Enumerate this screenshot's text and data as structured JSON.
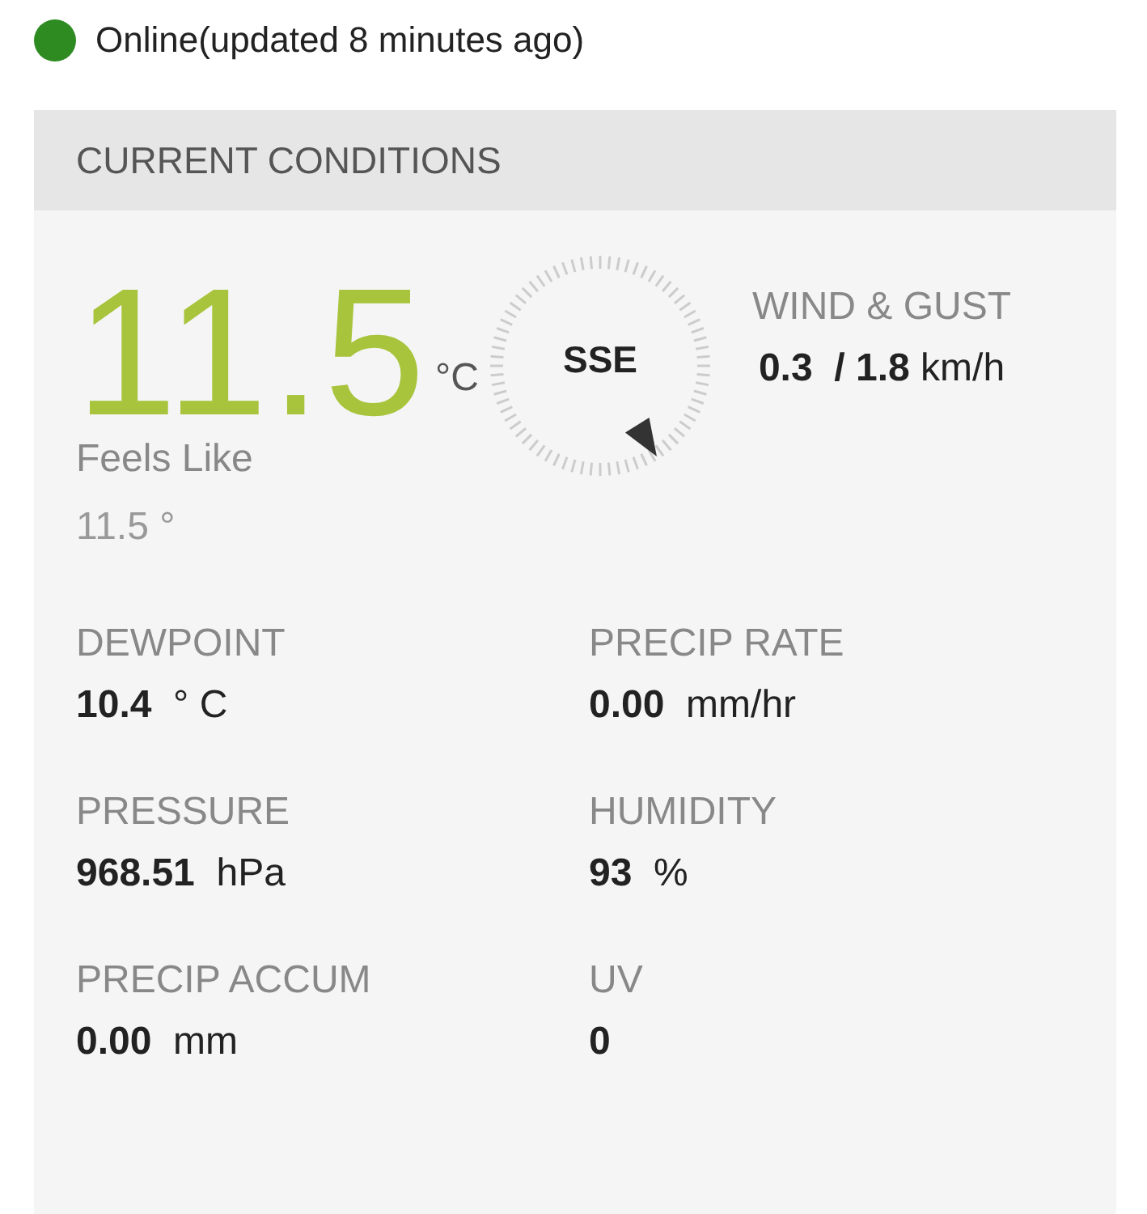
{
  "status": {
    "online": true,
    "text": "Online(updated 8 minutes ago)"
  },
  "card": {
    "title": "CURRENT CONDITIONS"
  },
  "temperature": {
    "value": "11.5",
    "unit": "°C"
  },
  "feels_like": {
    "label": "Feels Like",
    "value": "11.5 °"
  },
  "compass": {
    "direction": "SSE"
  },
  "wind": {
    "label": "WIND & GUST",
    "speed": "0.3",
    "separator": "/",
    "gust": "1.8",
    "unit": "km/h"
  },
  "metrics": [
    {
      "label": "DEWPOINT",
      "value": "10.4",
      "unit": "° C"
    },
    {
      "label": "PRECIP RATE",
      "value": "0.00",
      "unit": "mm/hr"
    },
    {
      "label": "PRESSURE",
      "value": "968.51",
      "unit": "hPa"
    },
    {
      "label": "HUMIDITY",
      "value": "93",
      "unit": "%"
    },
    {
      "label": "PRECIP ACCUM",
      "value": "0.00",
      "unit": "mm"
    },
    {
      "label": "UV",
      "value": "0"
    }
  ]
}
